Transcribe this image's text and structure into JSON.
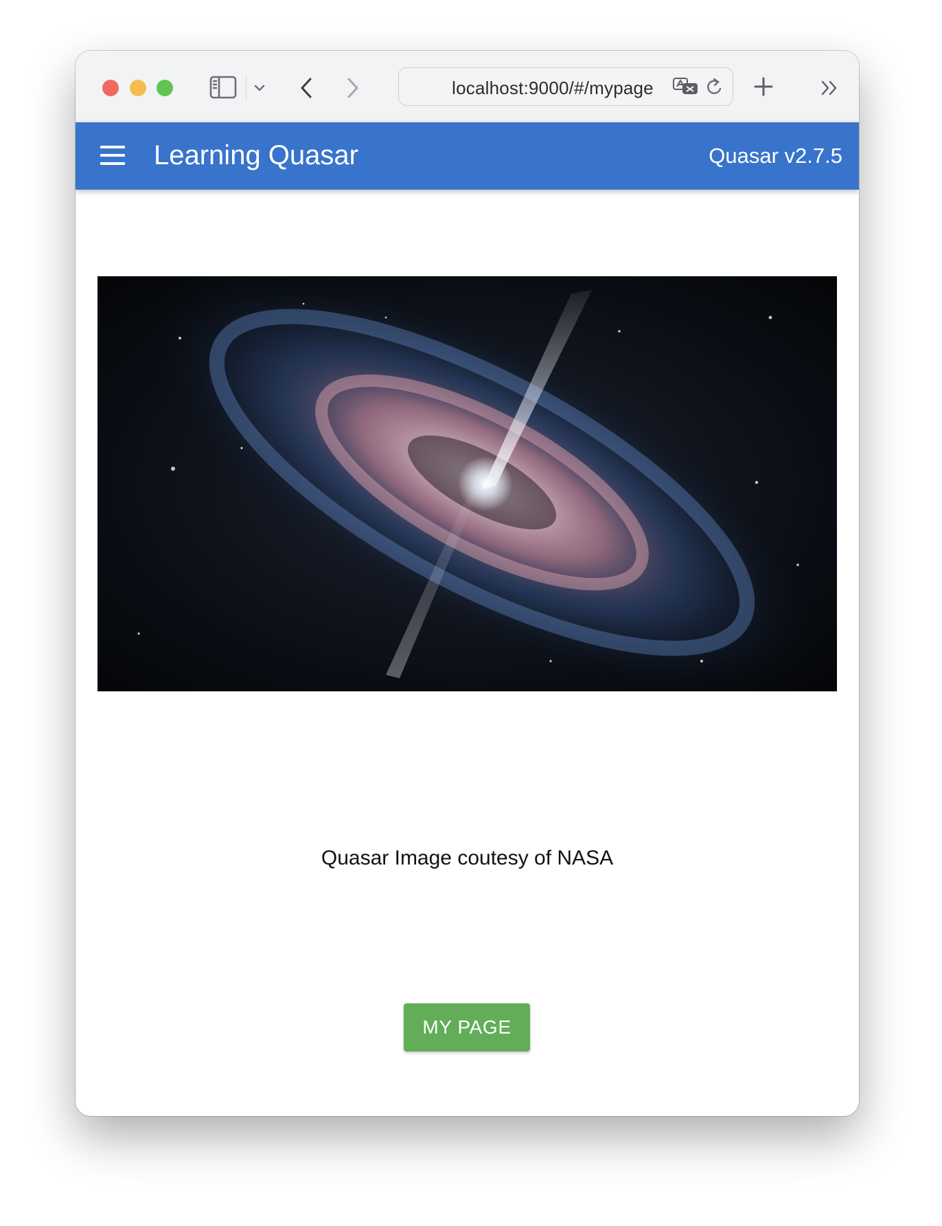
{
  "browser": {
    "address": "localhost:9000/#/mypage",
    "controls": {
      "sidebar_toggle_icon": "sidebar-icon",
      "sidebar_chevron_icon": "chevron-down-icon",
      "back_icon": "chevron-left-icon",
      "forward_icon": "chevron-right-icon",
      "translate_icon": "translate-icon",
      "reload_icon": "reload-icon",
      "new_tab_icon": "plus-icon",
      "overflow_icon": "double-chevron-right-icon"
    }
  },
  "header": {
    "menu_icon": "hamburger-menu-icon",
    "title": "Learning Quasar",
    "version": "Quasar v2.7.5",
    "background_color": "#3874cb"
  },
  "content": {
    "image_subject": "quasar galaxy illustration",
    "caption": "Quasar Image coutesy of NASA",
    "button_label": "MY PAGE",
    "button_color": "#63ad59"
  }
}
